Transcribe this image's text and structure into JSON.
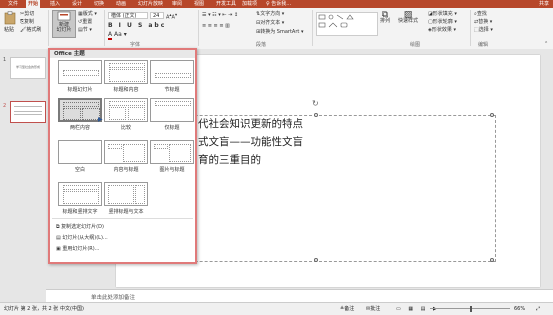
{
  "tabs": [
    "文件",
    "开始",
    "插入",
    "设计",
    "切换",
    "动画",
    "幻灯片放映",
    "审阅",
    "视图",
    "开发工具",
    "加载项",
    "♀ 告诉我…"
  ],
  "active_tab": "开始",
  "user": "共享",
  "clipboard": {
    "paste": "粘贴",
    "cut": "剪切",
    "copy": "复制",
    "format_painter": "格式刷"
  },
  "slides_group": {
    "new_slide": "新建\n幻灯片",
    "layout": "版式",
    "reset": "重置",
    "section": "节"
  },
  "font": {
    "name": "楷体 (正文)",
    "size": "24"
  },
  "paragraph": {
    "text_direction": "文字方向",
    "align_text": "对齐文本",
    "smartart": "转换为 SmartArt"
  },
  "drawing": {
    "arrange": "排列",
    "quick_styles": "快速样式",
    "shape_fill": "形状填充",
    "shape_outline": "形状轮廓",
    "shape_effect": "形状效果"
  },
  "editing": {
    "find": "查找",
    "replace": "替换",
    "select": "选择"
  },
  "group_labels": {
    "slides": "幻灯片",
    "font": "字体",
    "paragraph": "段落",
    "drawing": "绘图",
    "editing": "编辑"
  },
  "dropdown": {
    "header": "Office 主题",
    "layouts": [
      {
        "label": "标题幻灯片"
      },
      {
        "label": "标题和内容"
      },
      {
        "label": "节标题"
      },
      {
        "label": "两栏内容"
      },
      {
        "label": "比较"
      },
      {
        "label": "仅标题"
      },
      {
        "label": "空白"
      },
      {
        "label": "内容与标题"
      },
      {
        "label": "图片与标题"
      },
      {
        "label": "标题和竖排文字"
      },
      {
        "label": "竖排标题与文本"
      }
    ],
    "menu": [
      "复制选定幻灯片(D)",
      "幻灯片(从大纲)(L)...",
      "重用幻灯片(R)..."
    ]
  },
  "slide_text": [
    "代社会知识更新的特点",
    "式文盲——功能性文盲",
    "育的三重目的"
  ],
  "thumb_text": "学习型社会的形成",
  "notes_placeholder": "单击此处添加备注",
  "status": {
    "slide_info": "幻灯片 第 2 张，共 2 张",
    "lang": "中文(中国)",
    "notes": "备注",
    "comments": "批注",
    "zoom": "66%"
  }
}
